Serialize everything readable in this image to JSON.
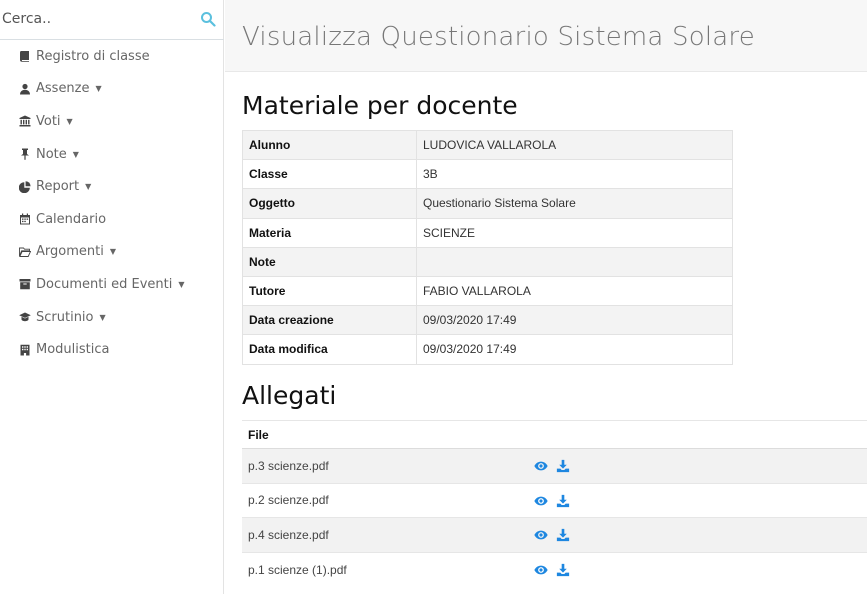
{
  "sidebar": {
    "search_placeholder": "Cerca..",
    "items": [
      {
        "label": "Registro di classe",
        "icon": "book-icon",
        "has_caret": false
      },
      {
        "label": "Assenze",
        "icon": "user-icon",
        "has_caret": true
      },
      {
        "label": "Voti",
        "icon": "bank-icon",
        "has_caret": true
      },
      {
        "label": "Note",
        "icon": "pushpin-icon",
        "has_caret": true
      },
      {
        "label": "Report",
        "icon": "pie-chart-icon",
        "has_caret": true
      },
      {
        "label": "Calendario",
        "icon": "calendar-icon",
        "has_caret": false
      },
      {
        "label": "Argomenti",
        "icon": "folder-open-icon",
        "has_caret": true
      },
      {
        "label": "Documenti ed Eventi",
        "icon": "archive-icon",
        "has_caret": true
      },
      {
        "label": "Scrutinio",
        "icon": "graduation-cap-icon",
        "has_caret": true
      },
      {
        "label": "Modulistica",
        "icon": "building-icon",
        "has_caret": false
      }
    ],
    "caret_glyph": "▼"
  },
  "header": {
    "title": "Visualizza Questionario Sistema Solare"
  },
  "materiale": {
    "heading": "Materiale per docente",
    "rows": [
      {
        "key": "Alunno",
        "value": "LUDOVICA VALLAROLA"
      },
      {
        "key": "Classe",
        "value": "3B"
      },
      {
        "key": "Oggetto",
        "value": "Questionario Sistema Solare"
      },
      {
        "key": "Materia",
        "value": "SCIENZE"
      },
      {
        "key": "Note",
        "value": ""
      },
      {
        "key": "Tutore",
        "value": "FABIO VALLAROLA"
      },
      {
        "key": "Data creazione",
        "value": "09/03/2020 17:49"
      },
      {
        "key": "Data modifica",
        "value": "09/03/2020 17:49"
      }
    ]
  },
  "allegati": {
    "heading": "Allegati",
    "column_header": "File",
    "files": [
      {
        "name": "p.3 scienze.pdf"
      },
      {
        "name": "p.2 scienze.pdf"
      },
      {
        "name": "p.4 scienze.pdf"
      },
      {
        "name": "p.1 scienze (1).pdf"
      }
    ],
    "action_icons": [
      "eye-icon",
      "download-icon"
    ]
  },
  "colors": {
    "accent": "#1e87e0",
    "search_icon": "#5bc0de",
    "header_bg": "#f7f7f7"
  }
}
